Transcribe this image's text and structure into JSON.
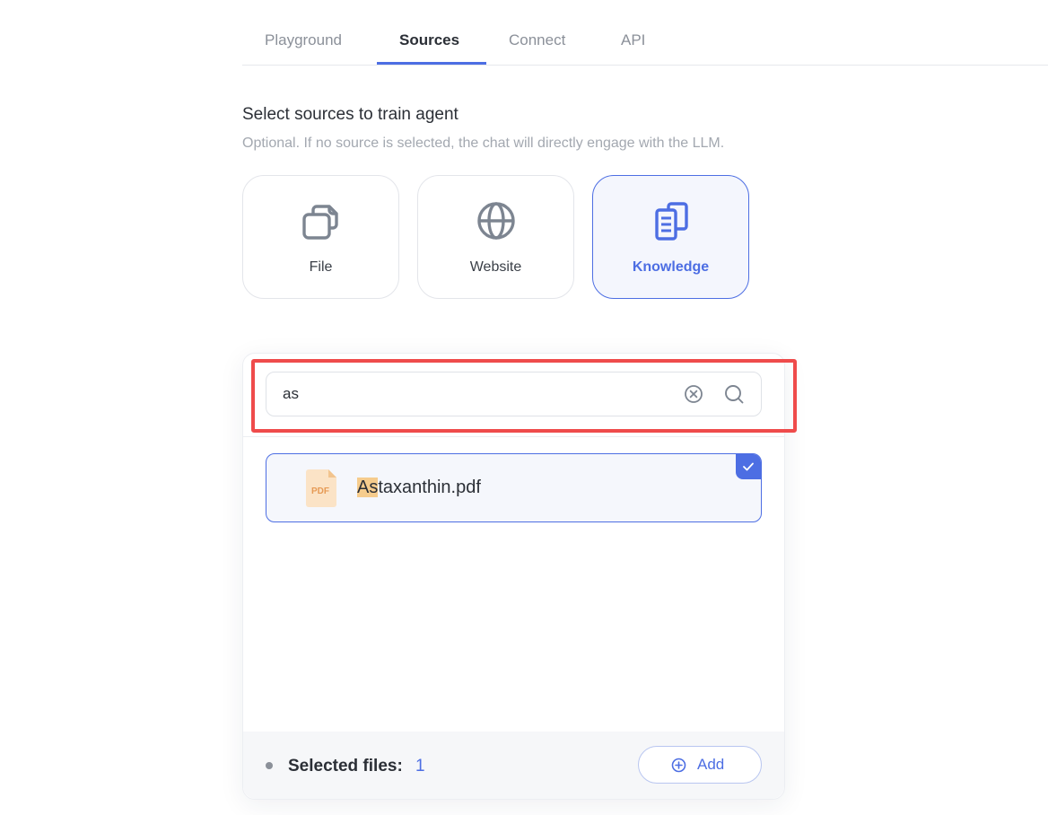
{
  "tabs": [
    {
      "label": "Playground"
    },
    {
      "label": "Sources"
    },
    {
      "label": "Connect"
    },
    {
      "label": "API"
    }
  ],
  "section": {
    "title": "Select sources to train agent",
    "subtitle": "Optional. If no source is selected, the chat will directly engage with the LLM."
  },
  "sources": [
    {
      "label": "File",
      "icon": "files-icon"
    },
    {
      "label": "Website",
      "icon": "globe-icon"
    },
    {
      "label": "Knowledge",
      "icon": "documents-icon"
    }
  ],
  "search": {
    "value": "as",
    "placeholder": ""
  },
  "files": [
    {
      "name_match": "As",
      "name_rest": "taxanthin.pdf",
      "type_label": "PDF",
      "selected": true
    }
  ],
  "footer": {
    "selected_label": "Selected files:",
    "selected_count": "1",
    "add_label": "Add"
  },
  "colors": {
    "accent": "#4d6ee3",
    "highlight": "#ef4b4b",
    "match": "#f6cc8d",
    "pdf": "#e69a55"
  }
}
